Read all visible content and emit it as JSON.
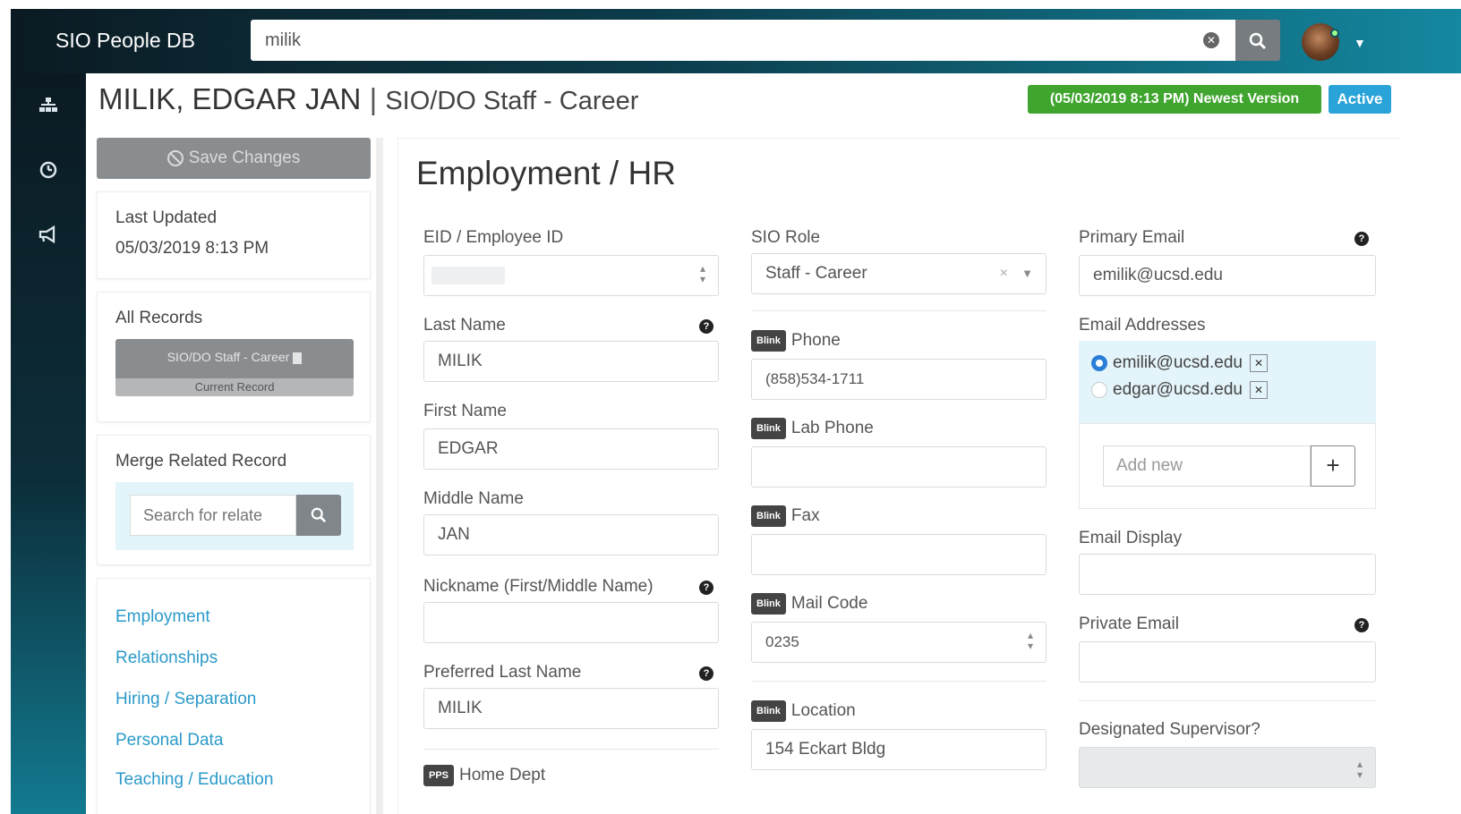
{
  "app": {
    "title": "SIO People DB"
  },
  "search": {
    "value": "milik"
  },
  "header": {
    "name": "MILIK, EDGAR JAN",
    "separator": "|",
    "role": "SIO/DO Staff - Career",
    "version_badge": "(05/03/2019 8:13 PM) Newest Version",
    "status_badge": "Active"
  },
  "sidebar": {
    "save_label": "Save Changes",
    "last_updated_label": "Last Updated",
    "last_updated_value": "05/03/2019 8:13 PM",
    "all_records_label": "All Records",
    "record_button": "SIO/DO Staff - Career",
    "record_sub": "Current Record",
    "merge_label": "Merge Related Record",
    "merge_placeholder": "Search for relate",
    "links": [
      "Employment",
      "Relationships",
      "Hiring / Separation",
      "Personal Data",
      "Teaching / Education"
    ]
  },
  "main": {
    "title": "Employment / HR",
    "col1": {
      "eid_label": "EID / Employee ID",
      "last_name_label": "Last Name",
      "last_name": "MILIK",
      "first_name_label": "First Name",
      "first_name": "EDGAR",
      "middle_name_label": "Middle Name",
      "middle_name": "JAN",
      "nickname_label": "Nickname (First/Middle Name)",
      "preferred_last_label": "Preferred Last Name",
      "preferred_last": "MILIK",
      "home_dept_badge": "PPS",
      "home_dept_label": "Home Dept"
    },
    "col2": {
      "role_label": "SIO Role",
      "role_value": "Staff - Career",
      "blink_badge": "Blink",
      "phone_label": "Phone",
      "phone_value": "(858)534-1711",
      "lab_phone_label": "Lab Phone",
      "fax_label": "Fax",
      "mail_code_label": "Mail Code",
      "mail_code_value": "0235",
      "location_label": "Location",
      "location_value": "154 Eckart Bldg"
    },
    "col3": {
      "primary_email_label": "Primary Email",
      "primary_email": "emilik@ucsd.edu",
      "addresses_label": "Email Addresses",
      "addresses": [
        "emilik@ucsd.edu",
        "edgar@ucsd.edu"
      ],
      "add_new_placeholder": "Add new",
      "display_label": "Email Display",
      "private_label": "Private Email",
      "supervisor_label": "Designated Supervisor?"
    }
  },
  "colors": {
    "active": "#2aa3d8",
    "newest": "#3fa52e",
    "link": "#2b9ac9"
  }
}
